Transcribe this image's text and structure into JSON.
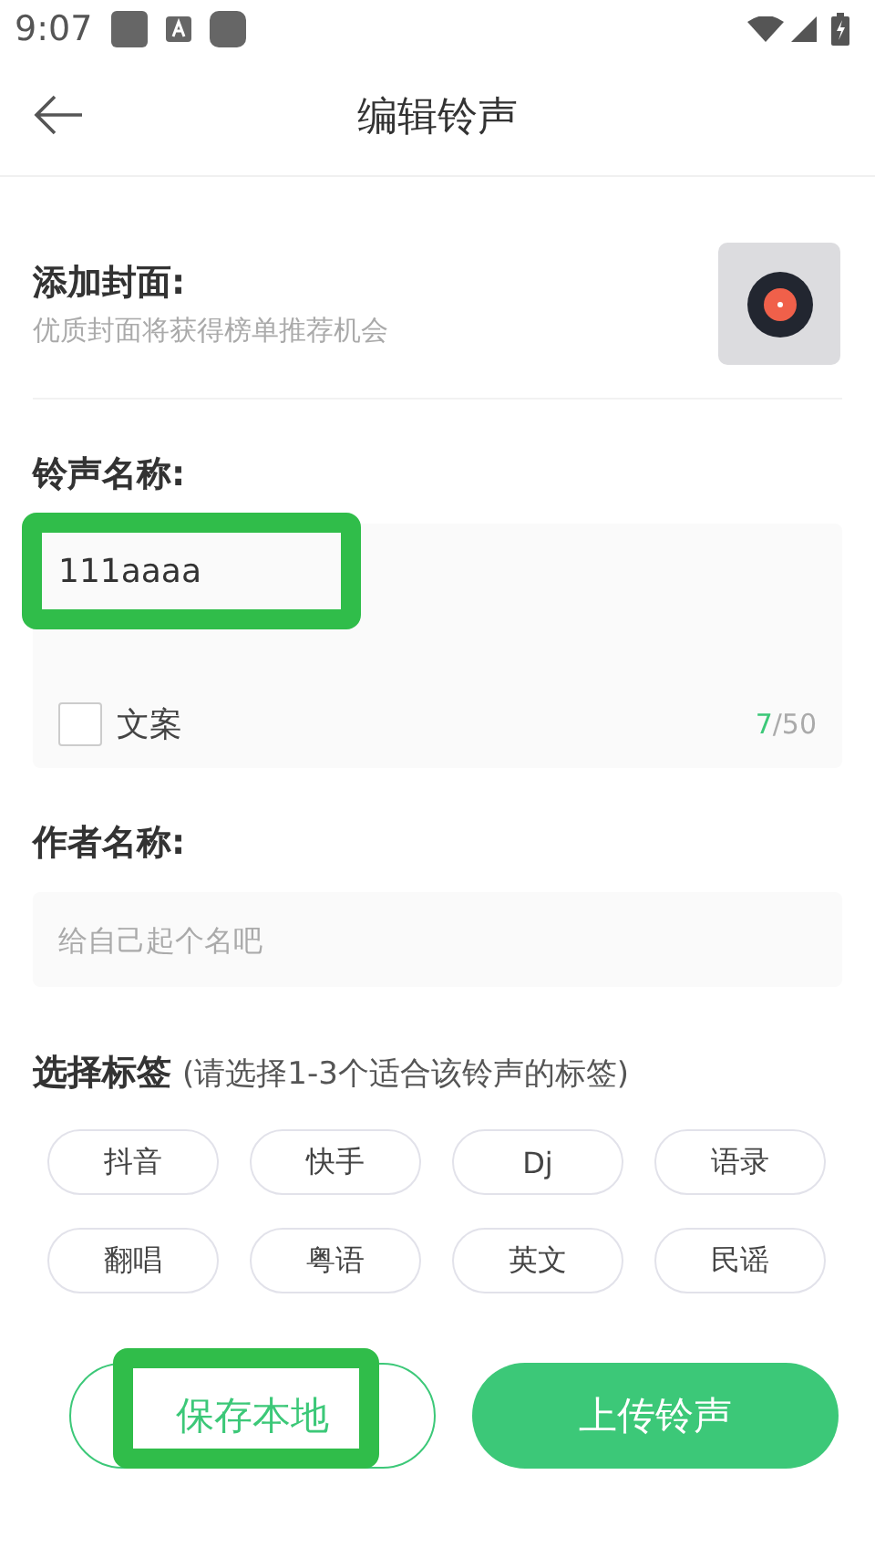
{
  "status_bar": {
    "time": "9:07"
  },
  "header": {
    "title": "编辑铃声"
  },
  "cover": {
    "label": "添加封面:",
    "hint": "优质封面将获得榜单推荐机会"
  },
  "ringtone_name": {
    "label": "铃声名称:",
    "value": "111aaaa",
    "highlighted": true,
    "copywriting": {
      "label": "文案",
      "checked": false
    },
    "count_current": "7",
    "count_max": "/50"
  },
  "author_name": {
    "label": "作者名称:",
    "placeholder": "给自己起个名吧"
  },
  "tags": {
    "label": "选择标签",
    "hint": "(请选择1-3个适合该铃声的标签)",
    "items": [
      {
        "label": "抖音",
        "selected": false
      },
      {
        "label": "快手",
        "selected": false
      },
      {
        "label": "Dj",
        "selected": false
      },
      {
        "label": "语录",
        "selected": false
      },
      {
        "label": "翻唱",
        "selected": false
      },
      {
        "label": "粤语",
        "selected": false
      },
      {
        "label": "英文",
        "selected": false
      },
      {
        "label": "民谣",
        "selected": false
      }
    ]
  },
  "buttons": [
    {
      "kind": "outline",
      "label": "保存本地",
      "highlighted": true
    },
    {
      "kind": "filled",
      "label": "上传铃声",
      "highlighted": false
    }
  ]
}
